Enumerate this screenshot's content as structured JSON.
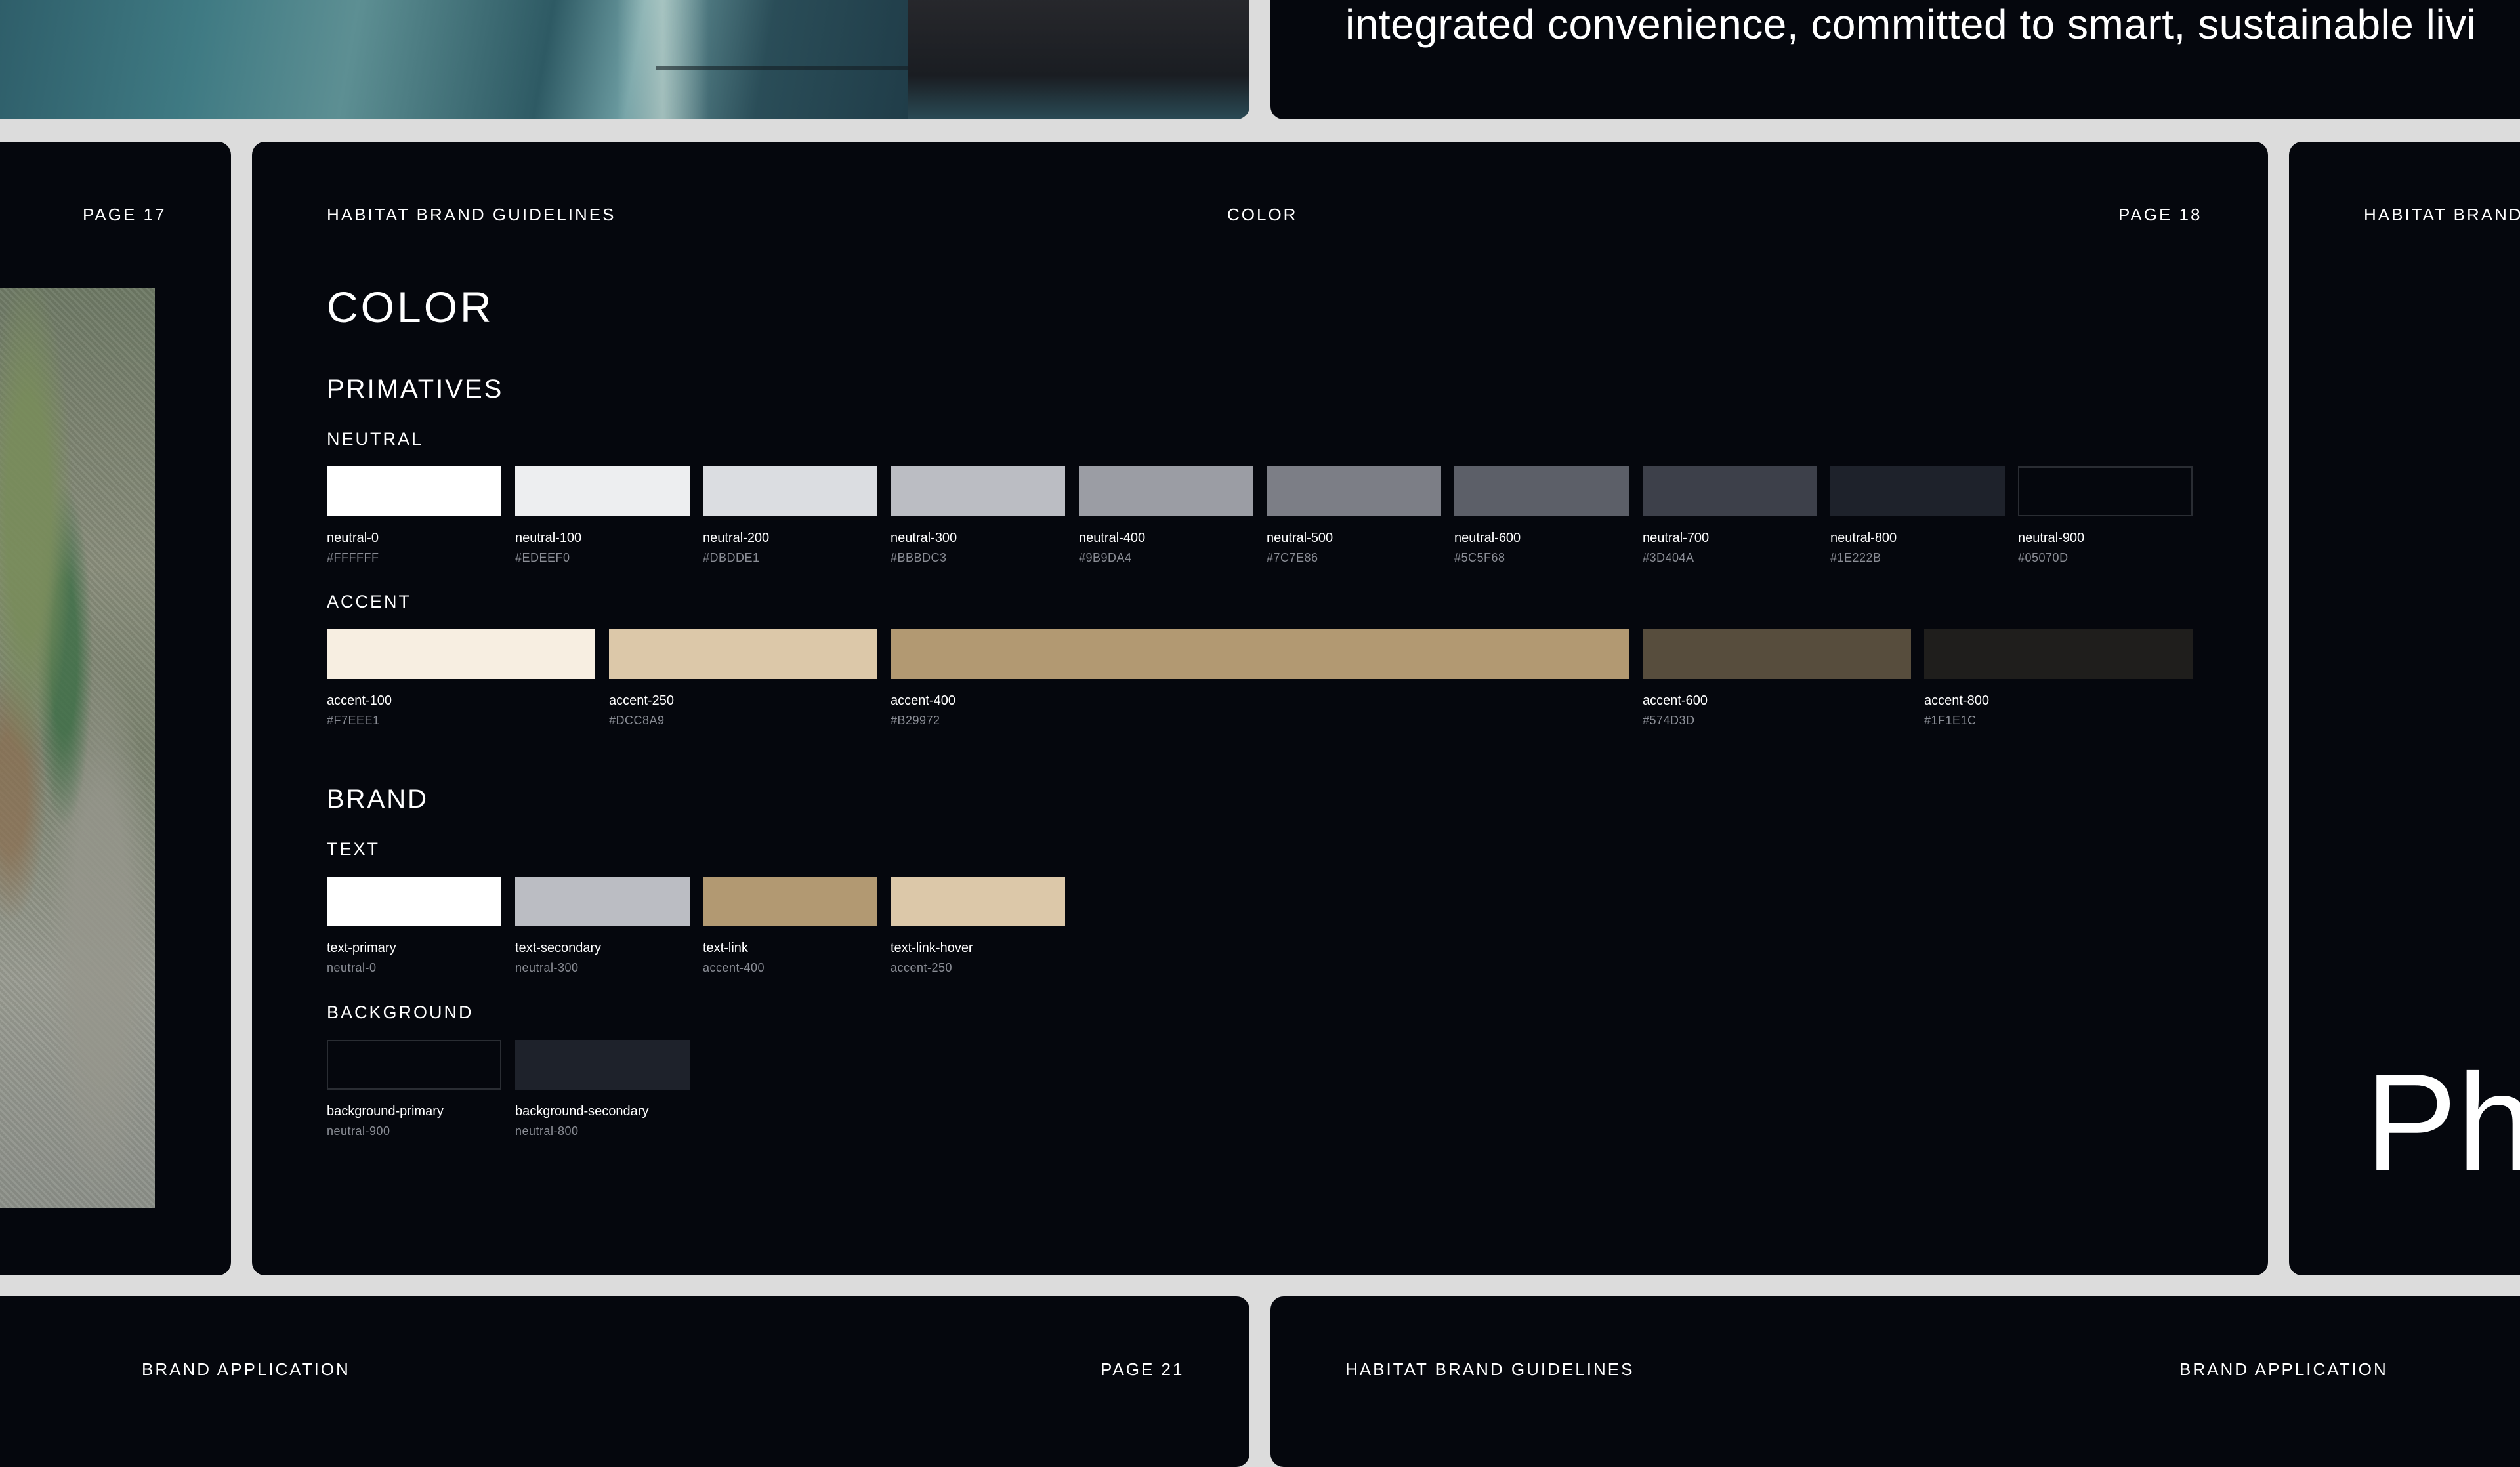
{
  "top_right": {
    "tagline": "integrated convenience, committed to smart, sustainable livi"
  },
  "left_panel": {
    "page": "PAGE 17"
  },
  "main": {
    "brand_guidelines": "HABITAT BRAND GUIDELINES",
    "section": "COLOR",
    "page": "PAGE 18",
    "title": "COLOR",
    "primatives_title": "PRIMATIVES",
    "neutral_title": "NEUTRAL",
    "neutral": [
      {
        "name": "neutral-0",
        "value": "#FFFFFF",
        "color": "#FFFFFF"
      },
      {
        "name": "neutral-100",
        "value": "#EDEEF0",
        "color": "#EDEEF0"
      },
      {
        "name": "neutral-200",
        "value": "#DBDDE1",
        "color": "#DBDDE1"
      },
      {
        "name": "neutral-300",
        "value": "#BBBDC3",
        "color": "#BBBDC3"
      },
      {
        "name": "neutral-400",
        "value": "#9B9DA4",
        "color": "#9B9DA4"
      },
      {
        "name": "neutral-500",
        "value": "#7C7E86",
        "color": "#7C7E86"
      },
      {
        "name": "neutral-600",
        "value": "#5C5F68",
        "color": "#5C5F68"
      },
      {
        "name": "neutral-700",
        "value": "#3D404A",
        "color": "#3D404A"
      },
      {
        "name": "neutral-800",
        "value": "#1E222B",
        "color": "#1E222B"
      },
      {
        "name": "neutral-900",
        "value": "#05070D",
        "color": "#05070D"
      }
    ],
    "accent_title": "ACCENT",
    "accent": [
      {
        "name": "accent-100",
        "value": "#F7EEE1",
        "color": "#F7EEE1"
      },
      {
        "name": "accent-250",
        "value": "#DCC8A9",
        "color": "#DCC8A9"
      },
      {
        "name": "accent-400",
        "value": "#B29972",
        "color": "#B29972"
      },
      {
        "name": "accent-600",
        "value": "#574D3D",
        "color": "#574D3D"
      },
      {
        "name": "accent-800",
        "value": "#1F1E1C",
        "color": "#1F1E1C"
      }
    ],
    "brand_title": "BRAND",
    "text_title": "TEXT",
    "text_colors": [
      {
        "name": "text-primary",
        "value": "neutral-0",
        "color": "#FFFFFF"
      },
      {
        "name": "text-secondary",
        "value": "neutral-300",
        "color": "#BBBDC3"
      },
      {
        "name": "text-link",
        "value": "accent-400",
        "color": "#B29972"
      },
      {
        "name": "text-link-hover",
        "value": "accent-250",
        "color": "#DCC8A9"
      }
    ],
    "background_title": "BACKGROUND",
    "background_colors": [
      {
        "name": "background-primary",
        "value": "neutral-900",
        "color": "#05070D"
      },
      {
        "name": "background-secondary",
        "value": "neutral-800",
        "color": "#1E222B"
      }
    ]
  },
  "right_panel": {
    "brand_guidelines": "HABITAT BRAND",
    "display_text": "Ph"
  },
  "bottom_left": {
    "section": "BRAND APPLICATION",
    "page": "PAGE 21"
  },
  "bottom_right": {
    "brand_guidelines": "HABITAT BRAND GUIDELINES",
    "section": "BRAND APPLICATION"
  }
}
